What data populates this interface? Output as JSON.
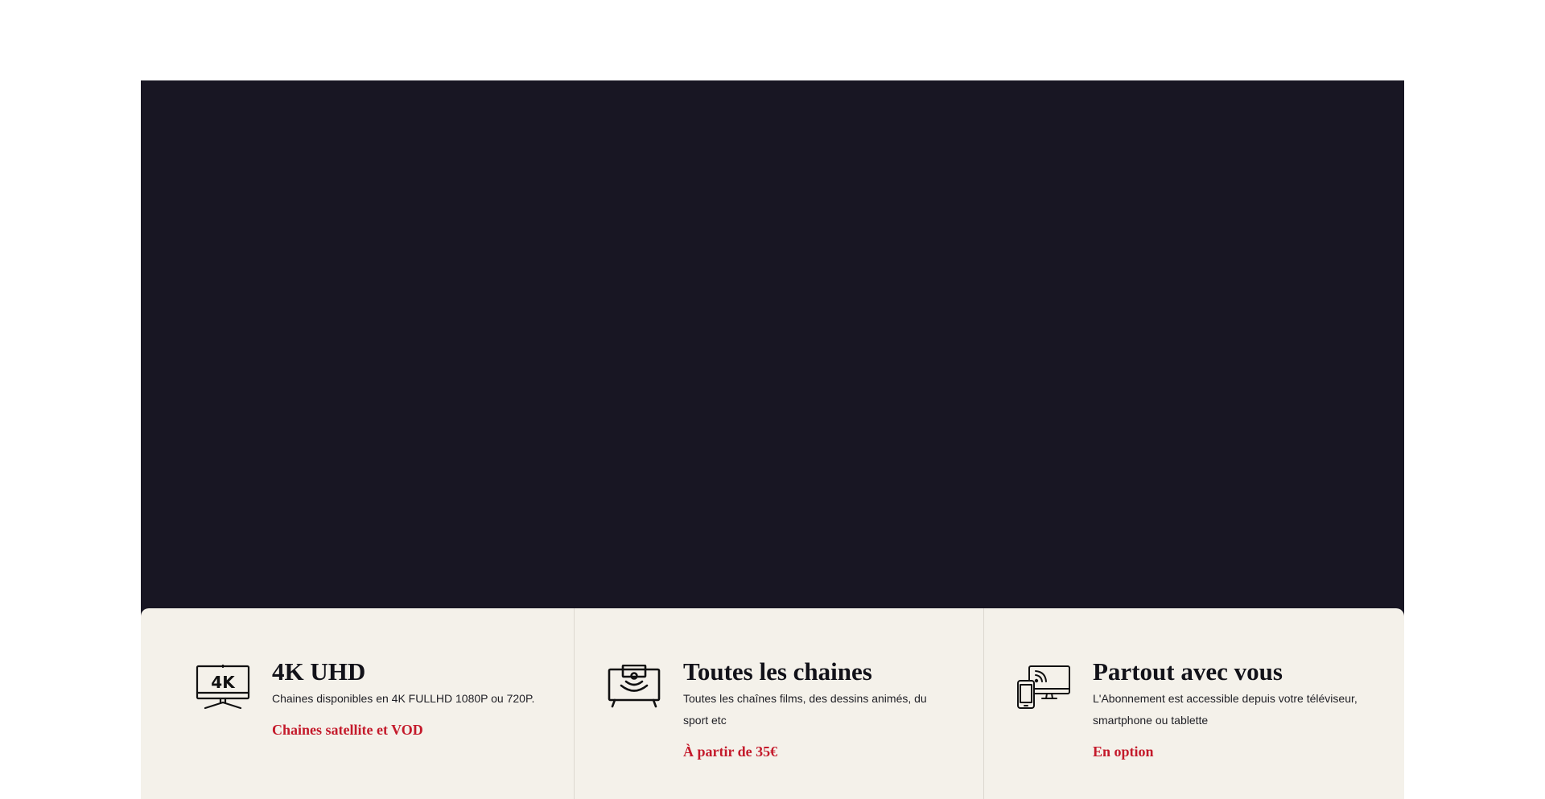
{
  "features": [
    {
      "icon": "tv-4k-icon",
      "icon_text": "4K",
      "title": "4K UHD",
      "description": "Chaines disponibles en 4K FULLHD 1080P ou 720P.",
      "link": "Chaines satellite et VOD"
    },
    {
      "icon": "tv-wifi-icon",
      "title": "Toutes les chaines",
      "description": "Toutes les chaînes films, des dessins animés, du sport etc",
      "link": "À partir de 35€"
    },
    {
      "icon": "multi-device-icon",
      "title": "Partout avec vous",
      "description": "L'Abonnement est accessible depuis votre téléviseur, smartphone ou tablette",
      "link": "En option"
    }
  ],
  "colors": {
    "hero_background": "#181623",
    "features_background": "#f4f1ea",
    "accent": "#c41a2b",
    "title": "#121219"
  }
}
